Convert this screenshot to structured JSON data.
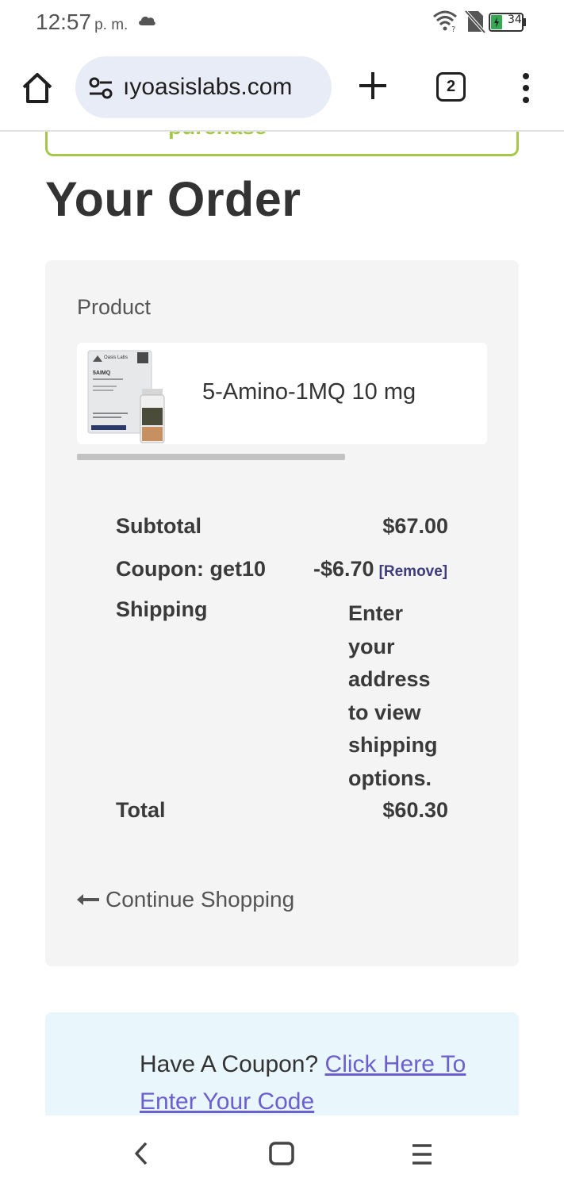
{
  "status_bar": {
    "time": "12:57",
    "ampm": "p. m.",
    "battery_level": "34",
    "icons": [
      "cloud-icon",
      "wifi-icon",
      "no-sim-icon",
      "battery-icon"
    ]
  },
  "browser": {
    "url": "ıyoasislabs.com",
    "tab_count": "2",
    "icons": [
      "home-icon",
      "site-settings-icon",
      "plus-icon",
      "tabs-icon",
      "more-vert-icon"
    ]
  },
  "page": {
    "purchase_button_label": "purchase",
    "title": "Your Order",
    "product_header": "Product",
    "product": {
      "name": "5-Amino-1MQ 10 mg",
      "thumb_brand": "Oasis Labs",
      "thumb_label": "5AIMQ"
    },
    "totals": {
      "subtotal_label": "Subtotal",
      "subtotal_value": "$67.00",
      "coupon_label": "Coupon: get10",
      "coupon_value": "-$6.70",
      "coupon_remove": "[Remove]",
      "shipping_label": "Shipping",
      "shipping_text": "Enter your address to view shipping options.",
      "total_label": "Total",
      "total_value": "$60.30"
    },
    "continue_shopping": "Continue Shopping",
    "coupon_prompt": "Have A Coupon?",
    "coupon_link": "Click Here To Enter Your Code"
  },
  "colors": {
    "accent_green": "#a6c84a",
    "link_purple": "#6c5fd0",
    "card_bg": "#f4f4f4",
    "coupon_bg": "#e9f6fc",
    "url_pill_bg": "#e8ecf6"
  }
}
